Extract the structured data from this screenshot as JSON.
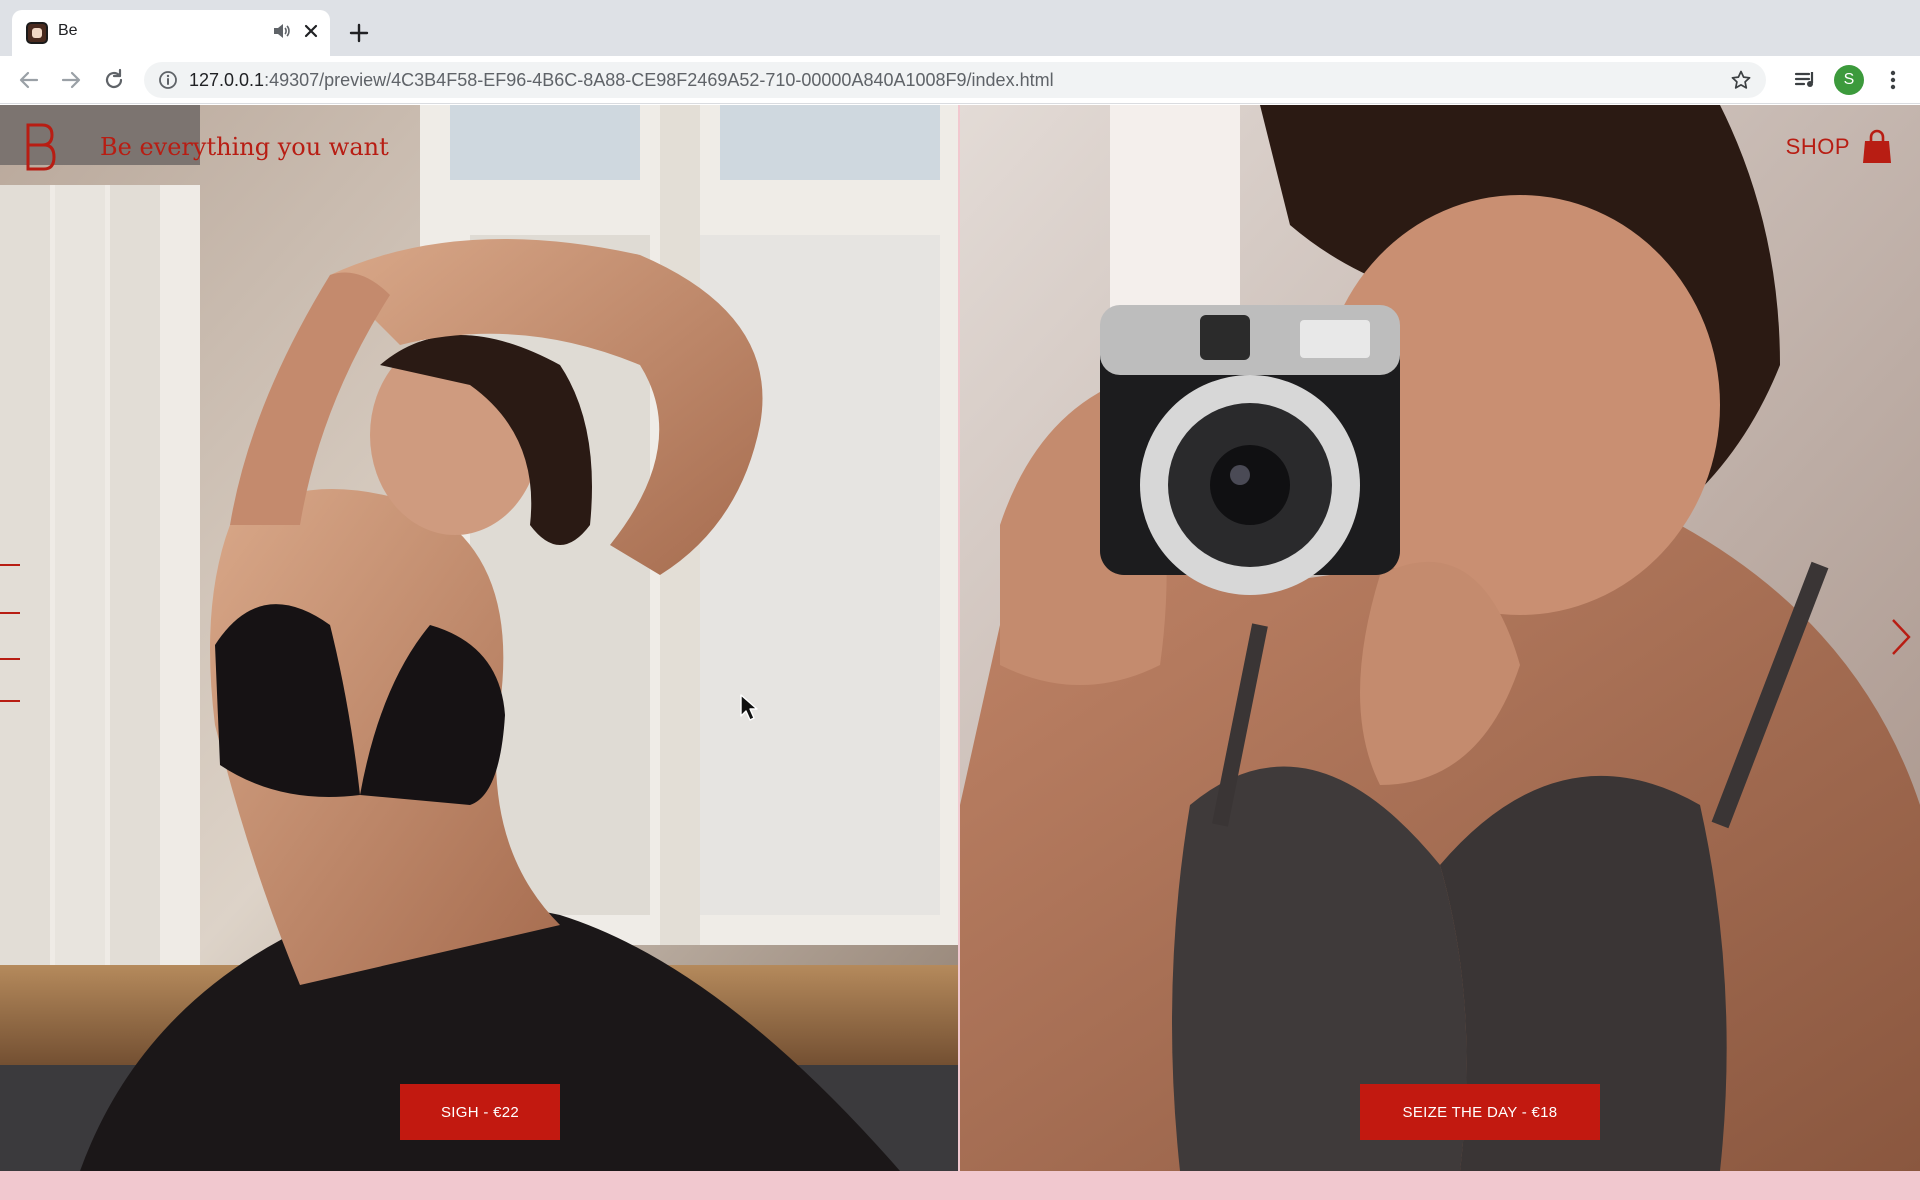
{
  "browser": {
    "tab": {
      "title": "Be"
    },
    "address": {
      "host": "127.0.0.1",
      "rest": ":49307/preview/4C3B4F58-EF96-4B6C-8A88-CE98F2469A52-710-00000A840A1008F9/index.html"
    },
    "profile_initial": "S"
  },
  "site": {
    "tagline": "Be everything you want",
    "shop_label": "SHOP",
    "accent_color": "#b81d13",
    "footer_color": "#f1c8cf"
  },
  "products": [
    {
      "label": "SIGH - €22",
      "photo": "woman stretching in black lace bra"
    },
    {
      "label": "SEIZE THE DAY - €18",
      "photo": "woman taking photo with instant camera in grey bra"
    }
  ],
  "icons": {
    "back": "arrow-left-icon",
    "forward": "arrow-right-icon",
    "reload": "reload-icon",
    "info": "info-icon",
    "bookmark": "star-icon",
    "media": "media-queue-icon",
    "menu": "kebab-menu-icon",
    "shop": "shopping-bag-icon",
    "next": "chevron-right-icon"
  }
}
